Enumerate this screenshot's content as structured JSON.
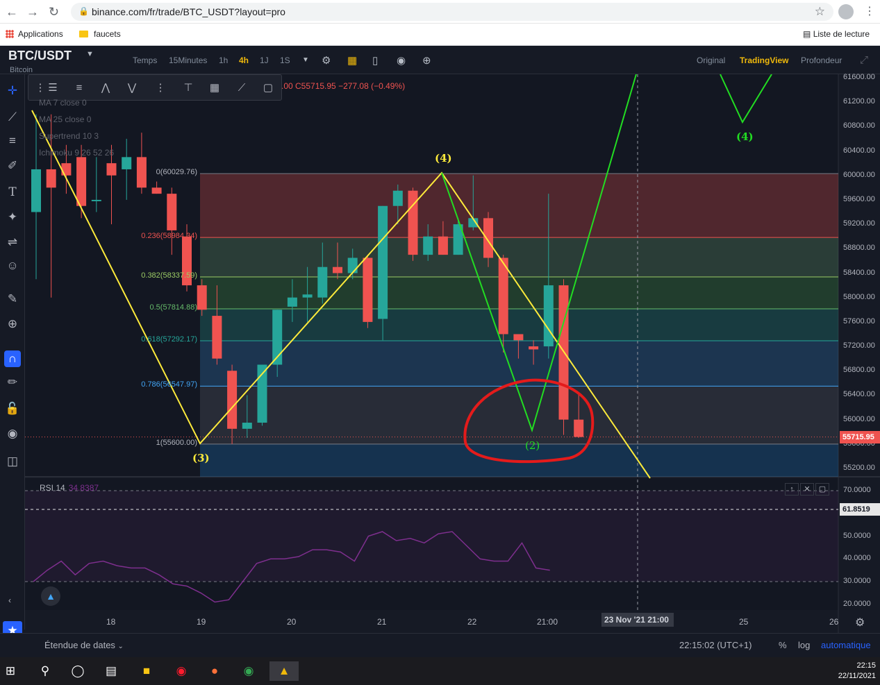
{
  "browser": {
    "url": "binance.com/fr/trade/BTC_USDT?layout=pro",
    "bookmarks": [
      "Applications",
      "faucets"
    ],
    "reading_list": "Liste de lecture"
  },
  "header": {
    "pair": "BTC/USDT",
    "pair_sub": "Bitcoin",
    "time_label": "Temps",
    "timeframes": [
      "15Minutes",
      "1h",
      "4h",
      "1J",
      "1S"
    ],
    "active_timeframe": "4h",
    "views": [
      "Original",
      "TradingView",
      "Profondeur"
    ],
    "active_view": "TradingView"
  },
  "legend": {
    "ohlc": ".00 C55715.95 −277.08 (−0.49%)",
    "indicators": [
      "MA 7 close 0",
      "MA 25 close 0",
      "Supertrend 10 3",
      "Ichimoku 9 26 52 26"
    ]
  },
  "fib_levels": [
    {
      "label": "0(60029.76)",
      "color": "#b2b5be"
    },
    {
      "label": "0.236(58984.34)",
      "color": "#ef5350"
    },
    {
      "label": "0.382(58337.59)",
      "color": "#9ccc65"
    },
    {
      "label": "0.5(57814.88)",
      "color": "#66bb6a"
    },
    {
      "label": "0.618(57292.17)",
      "color": "#26a69a"
    },
    {
      "label": "0.786(56547.97)",
      "color": "#42a5f5"
    },
    {
      "label": "1(55600.00)",
      "color": "#b2b5be"
    }
  ],
  "wave_labels": {
    "w3": "(3)",
    "w4": "(4)",
    "w2": "(2)",
    "w4_future": "(4)"
  },
  "price_scale": [
    "61600.00",
    "61200.00",
    "60800.00",
    "60400.00",
    "60000.00",
    "59600.00",
    "59200.00",
    "58800.00",
    "58400.00",
    "58000.00",
    "57600.00",
    "57200.00",
    "56800.00",
    "56400.00",
    "56000.00",
    "55600.00",
    "55200.00"
  ],
  "current_price": "55715.95",
  "rsi": {
    "label": "RSI 14",
    "value": "34.8387",
    "scale": [
      "70.0000",
      "50.0000",
      "40.0000",
      "30.0000",
      "20.0000"
    ],
    "marker": "61.8519"
  },
  "time_scale": [
    "18",
    "19",
    "20",
    "21",
    "22",
    "21:00",
    "25",
    "26"
  ],
  "date_badge": "23 Nov '21   21:00",
  "bottom": {
    "date_range": "Étendue de dates",
    "clock": "22:15:02 (UTC+1)",
    "percent": "%",
    "log": "log",
    "auto": "automatique"
  },
  "tray": {
    "time": "22:15",
    "date": "22/11/2021"
  },
  "colors": {
    "up": "#26a69a",
    "down": "#ef5350",
    "accent": "#f0b90b",
    "wave_yellow": "#ffeb3b",
    "wave_green": "#22dd22",
    "circle": "#e41b1b"
  },
  "candles": [
    {
      "o": 59400,
      "h": 61000,
      "l": 58300,
      "c": 60100
    },
    {
      "o": 60100,
      "h": 61000,
      "l": 58000,
      "c": 59800
    },
    {
      "o": 60200,
      "h": 60500,
      "l": 59700,
      "c": 60000
    },
    {
      "o": 60300,
      "h": 60500,
      "l": 59300,
      "c": 59500
    },
    {
      "o": 59600,
      "h": 60300,
      "l": 59400,
      "c": 59600
    },
    {
      "o": 60200,
      "h": 60500,
      "l": 59200,
      "c": 60000
    },
    {
      "o": 60100,
      "h": 60600,
      "l": 59600,
      "c": 60300
    },
    {
      "o": 60300,
      "h": 60700,
      "l": 59700,
      "c": 59800
    },
    {
      "o": 59800,
      "h": 59900,
      "l": 59700,
      "c": 59700
    },
    {
      "o": 59700,
      "h": 59800,
      "l": 58700,
      "c": 59100
    },
    {
      "o": 59000,
      "h": 59200,
      "l": 58100,
      "c": 58200
    },
    {
      "o": 58200,
      "h": 58300,
      "l": 57700,
      "c": 57800
    },
    {
      "o": 57700,
      "h": 58200,
      "l": 56900,
      "c": 57000
    },
    {
      "o": 56800,
      "h": 56900,
      "l": 55600,
      "c": 55850
    },
    {
      "o": 55850,
      "h": 56400,
      "l": 55700,
      "c": 55950
    },
    {
      "o": 55950,
      "h": 56900,
      "l": 55900,
      "c": 56900
    },
    {
      "o": 56900,
      "h": 57800,
      "l": 56700,
      "c": 57800
    },
    {
      "o": 57850,
      "h": 58300,
      "l": 57600,
      "c": 58000
    },
    {
      "o": 58000,
      "h": 58500,
      "l": 57600,
      "c": 58050
    },
    {
      "o": 58000,
      "h": 58900,
      "l": 57900,
      "c": 58500
    },
    {
      "o": 58500,
      "h": 58900,
      "l": 58300,
      "c": 58400
    },
    {
      "o": 58400,
      "h": 58800,
      "l": 58300,
      "c": 58650
    },
    {
      "o": 58650,
      "h": 58700,
      "l": 57500,
      "c": 57600
    },
    {
      "o": 57650,
      "h": 59500,
      "l": 57300,
      "c": 59500
    },
    {
      "o": 59500,
      "h": 59850,
      "l": 59200,
      "c": 59750
    },
    {
      "o": 59750,
      "h": 59800,
      "l": 58600,
      "c": 58700
    },
    {
      "o": 58700,
      "h": 59200,
      "l": 58600,
      "c": 59000
    },
    {
      "o": 59000,
      "h": 59250,
      "l": 58700,
      "c": 58700
    },
    {
      "o": 58700,
      "h": 59300,
      "l": 58700,
      "c": 59200
    },
    {
      "o": 59150,
      "h": 60000,
      "l": 59100,
      "c": 59300
    },
    {
      "o": 59300,
      "h": 59400,
      "l": 58500,
      "c": 58650
    },
    {
      "o": 58650,
      "h": 58700,
      "l": 57100,
      "c": 57400
    },
    {
      "o": 57400,
      "h": 57400,
      "l": 57000,
      "c": 57300
    },
    {
      "o": 57200,
      "h": 57300,
      "l": 56900,
      "c": 57150
    },
    {
      "o": 57200,
      "h": 59700,
      "l": 57000,
      "c": 58200
    },
    {
      "o": 58200,
      "h": 58300,
      "l": 55750,
      "c": 56000
    },
    {
      "o": 56000,
      "h": 56450,
      "l": 55700,
      "c": 55716
    }
  ],
  "rsi_values": [
    30,
    35,
    39,
    33,
    38,
    39,
    37,
    36,
    36,
    33,
    29,
    28,
    25,
    21,
    22,
    30,
    38,
    40,
    40,
    41,
    44,
    44,
    43,
    39,
    50,
    52,
    48,
    49,
    47,
    51,
    52,
    46,
    40,
    39,
    39,
    47,
    36,
    35
  ]
}
